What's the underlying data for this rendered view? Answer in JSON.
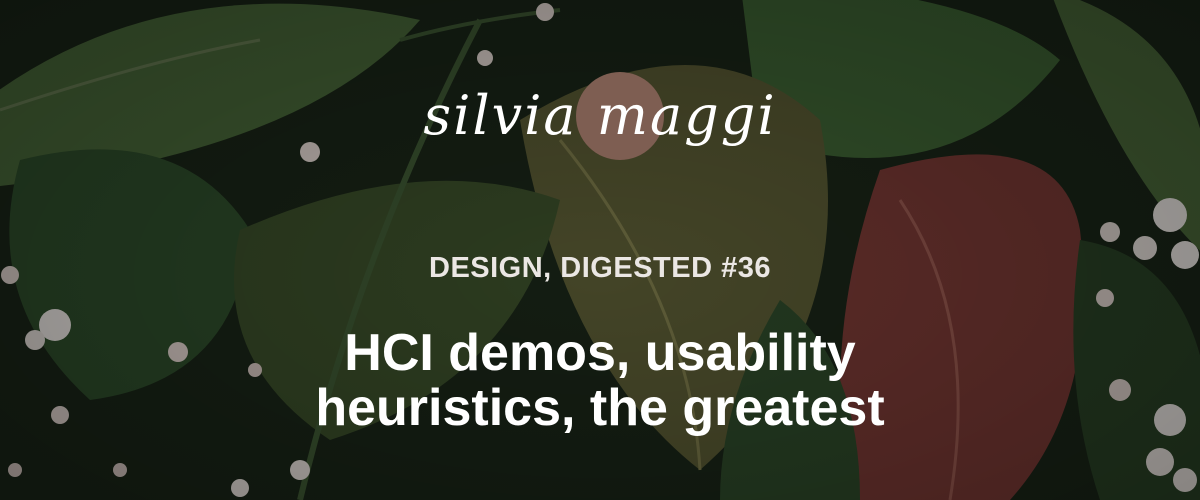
{
  "brand": {
    "logo_text": "silvia maggi",
    "circle_color": "#7e5e52"
  },
  "header": {
    "eyebrow": "DESIGN, DIGESTED #36",
    "title_line_1": "HCI demos, usability",
    "title_line_2": "heuristics, the greatest"
  },
  "background": {
    "description_icon": "leaves-photo",
    "leaf_color": "#3c5a30",
    "red_leaf_color": "#7a3a35",
    "blossom_color": "#f1ece8"
  }
}
